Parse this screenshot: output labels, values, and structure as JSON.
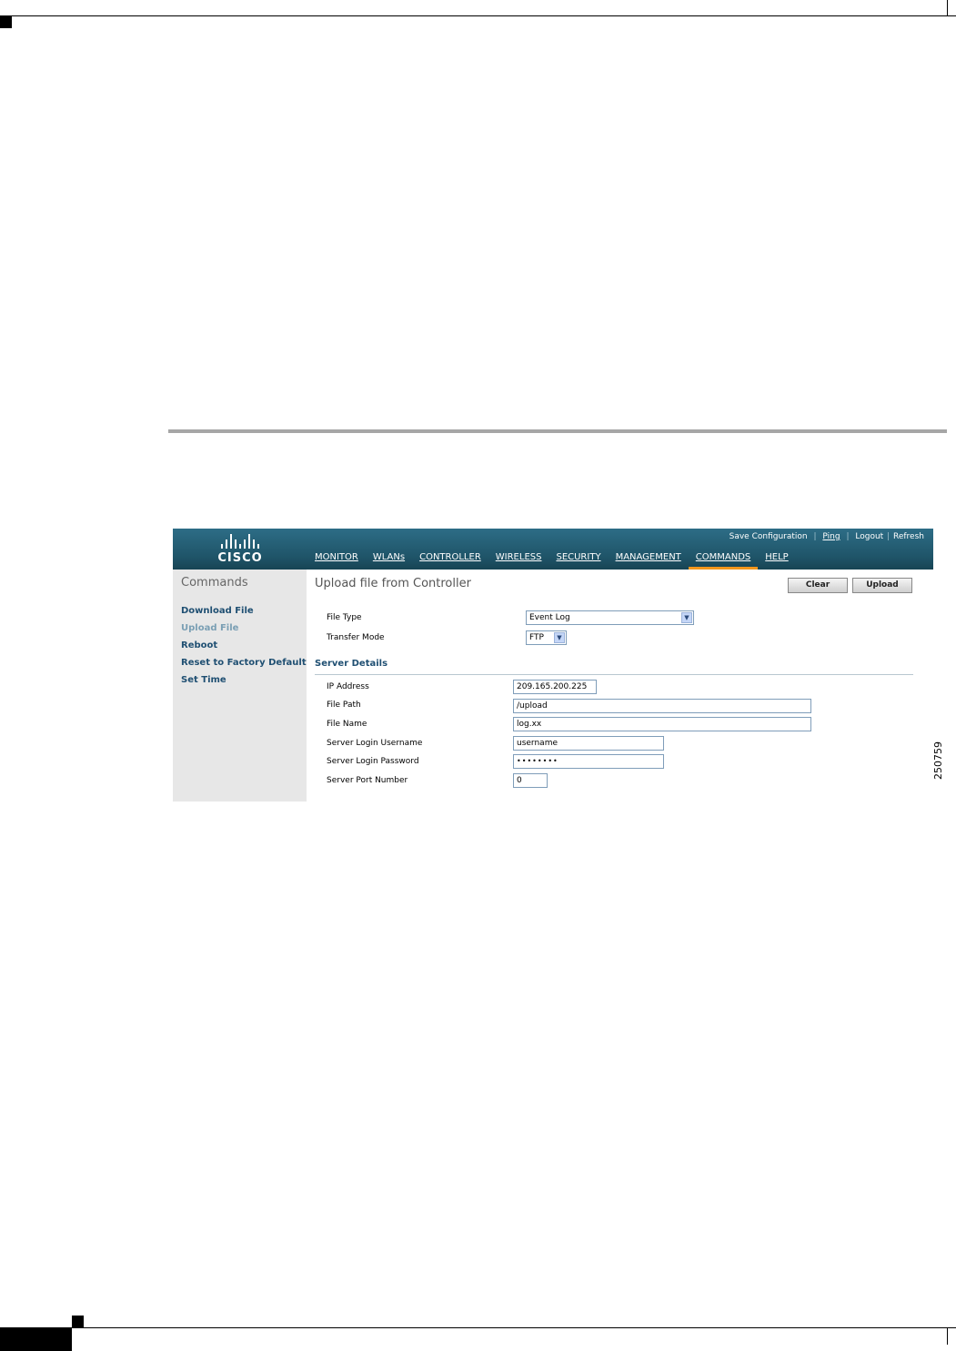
{
  "figure_id": "250759",
  "header": {
    "brand": "CISCO",
    "utility_links": [
      {
        "label": "Save Configuration"
      },
      {
        "label": "Ping"
      },
      {
        "label": "Logout"
      },
      {
        "label": "Refresh"
      }
    ],
    "separator": "|",
    "nav": [
      {
        "label": "MONITOR"
      },
      {
        "label": "WLANs"
      },
      {
        "label": "CONTROLLER"
      },
      {
        "label": "WIRELESS"
      },
      {
        "label": "SECURITY"
      },
      {
        "label": "MANAGEMENT"
      },
      {
        "label": "COMMANDS"
      },
      {
        "label": "HELP"
      }
    ],
    "active_nav": "COMMANDS",
    "accent_color": "#f3961c"
  },
  "sidebar": {
    "title": "Commands",
    "items": [
      {
        "label": "Download File"
      },
      {
        "label": "Upload File"
      },
      {
        "label": "Reboot"
      },
      {
        "label": "Reset to Factory Default"
      },
      {
        "label": "Set Time"
      }
    ],
    "current_item": "Upload File"
  },
  "main": {
    "title": "Upload file from Controller",
    "clear_label": "Clear",
    "upload_label": "Upload",
    "file_type": {
      "label": "File Type",
      "value": "Event Log"
    },
    "transfer_mode": {
      "label": "Transfer Mode",
      "value": "FTP"
    },
    "server_details": {
      "heading": "Server Details",
      "ip_address": {
        "label": "IP Address",
        "value": "209.165.200.225"
      },
      "file_path": {
        "label": "File Path",
        "value": "/upload"
      },
      "file_name": {
        "label": "File Name",
        "value": "log.xx"
      },
      "login_username": {
        "label": "Server Login Username",
        "value": "username"
      },
      "login_password": {
        "label": "Server Login Password",
        "value": "••••••••"
      },
      "port_number": {
        "label": "Server Port Number",
        "value": "0"
      }
    }
  }
}
